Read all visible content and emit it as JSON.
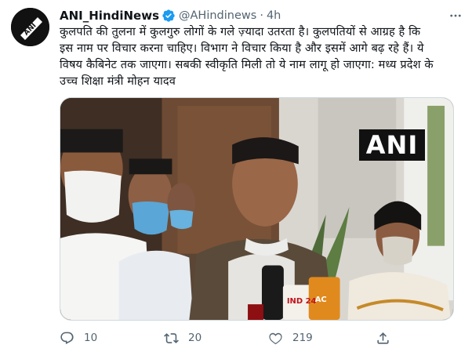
{
  "tweet": {
    "display_name": "ANI_HindiNews",
    "handle": "@AHindinews",
    "separator": "·",
    "time": "4h",
    "avatar_text": "ANI",
    "text_lines": [
      "कुलपति की तुलना में कुलगुरु लोगों के गले ज़्यादा उतरता है। कुलपतियों से आग्रह है कि",
      "इस नाम पर विचार करना चाहिए। विभाग ने विचार किया है और इसमें आगे बढ़ रहे हैं। ये",
      "विषय कैबिनेट तक जाएगा। सबकी स्वीकृति मिली तो ये नाम लागू हो जाएगा: मध्य प्रदेश के",
      "उच्च शिक्षा मंत्री मोहन यादव"
    ]
  },
  "media": {
    "watermark": "ANI",
    "mic_label_1": "IND 24",
    "mic_label_2": "AC"
  },
  "actions": {
    "reply": {
      "icon": "reply-icon",
      "count": "10"
    },
    "retweet": {
      "icon": "retweet-icon",
      "count": "20"
    },
    "like": {
      "icon": "heart-icon",
      "count": "219"
    },
    "share": {
      "icon": "share-icon"
    }
  },
  "colors": {
    "text_primary": "#0f1419",
    "text_secondary": "#536471",
    "verified_blue": "#1d9bf0",
    "border": "#cfd9de"
  }
}
